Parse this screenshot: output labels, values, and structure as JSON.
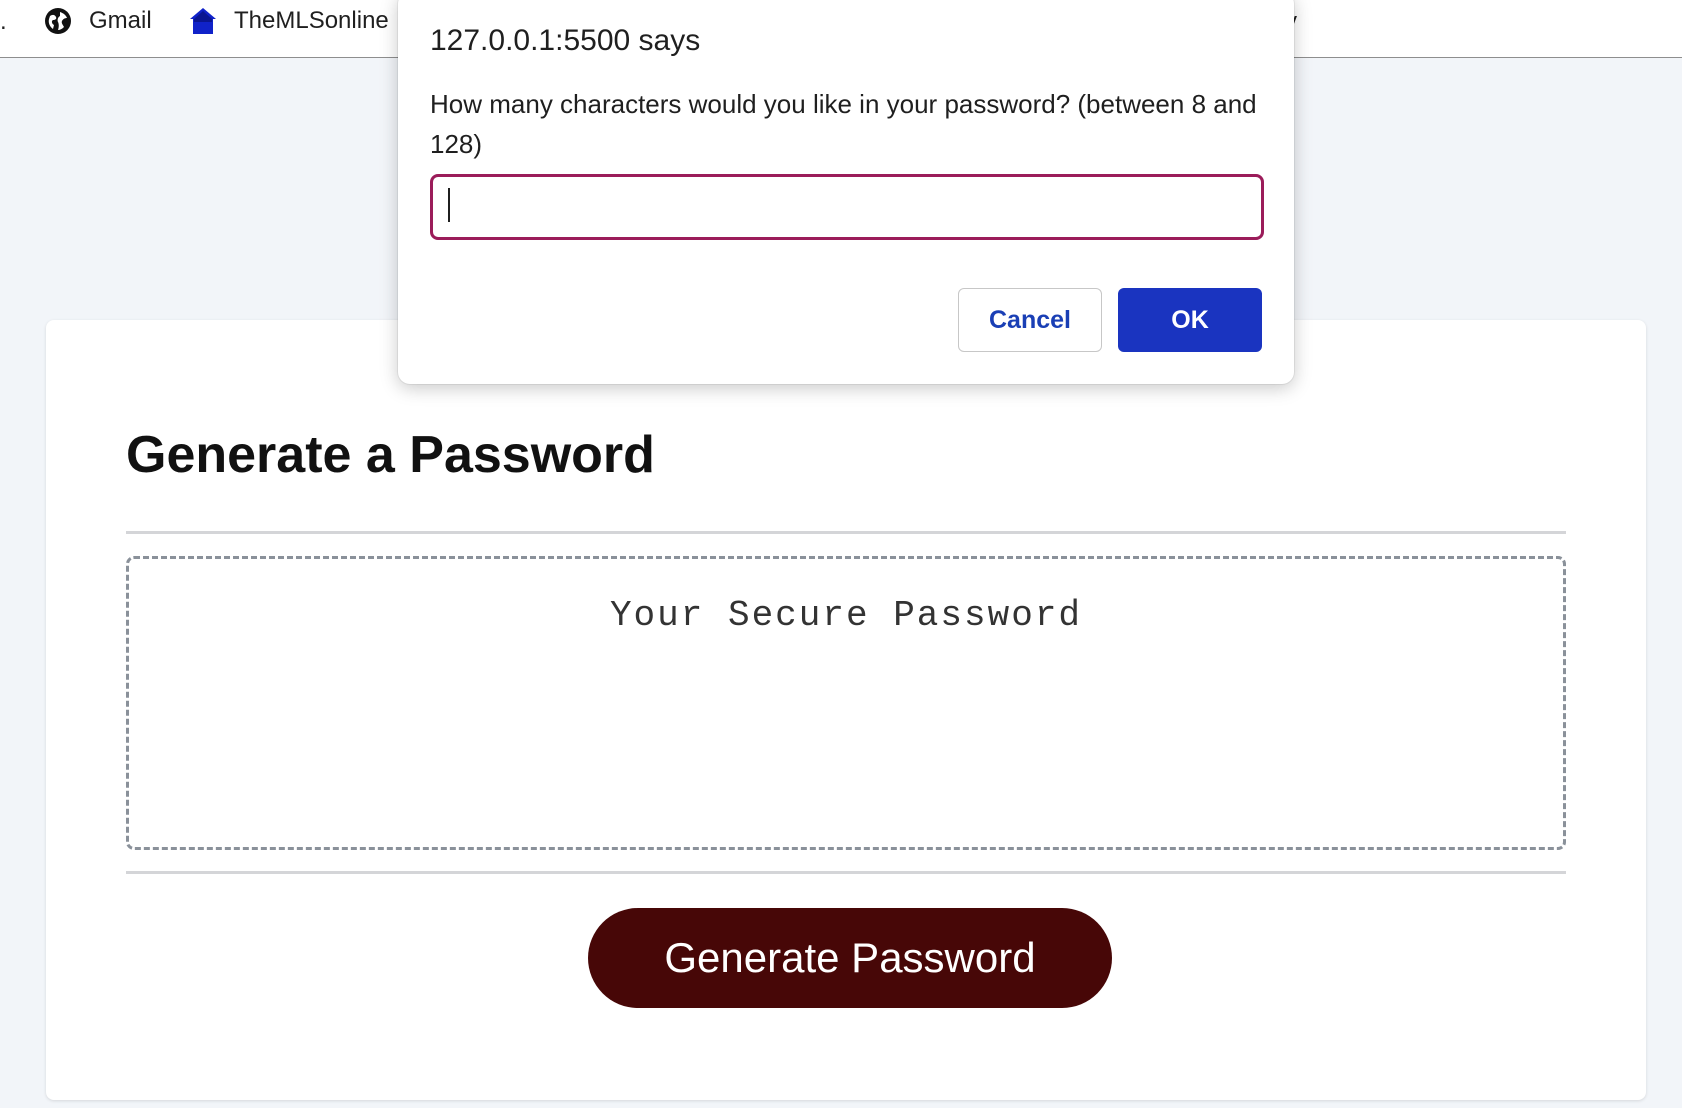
{
  "bookmarks": {
    "leading_ellipsis": ".",
    "items": [
      {
        "label": "Gmail",
        "icon": "globe-icon"
      },
      {
        "label": "TheMLSonline",
        "icon": "house-icon"
      }
    ],
    "trailing_fragment": "y"
  },
  "page": {
    "title": "Generate a Password",
    "password_placeholder": "Your Secure Password",
    "generate_button": "Generate Password"
  },
  "dialog": {
    "origin": "127.0.0.1:5500 says",
    "message": "How many characters would you like in your password? (between 8 and 128)",
    "input_value": "",
    "cancel_label": "Cancel",
    "ok_label": "OK"
  },
  "colors": {
    "page_background": "#f2f5f9",
    "generate_button": "#470707",
    "ok_button": "#1a34c0",
    "input_focus_border": "#9b1c5a",
    "password_border": "#8a919a"
  }
}
